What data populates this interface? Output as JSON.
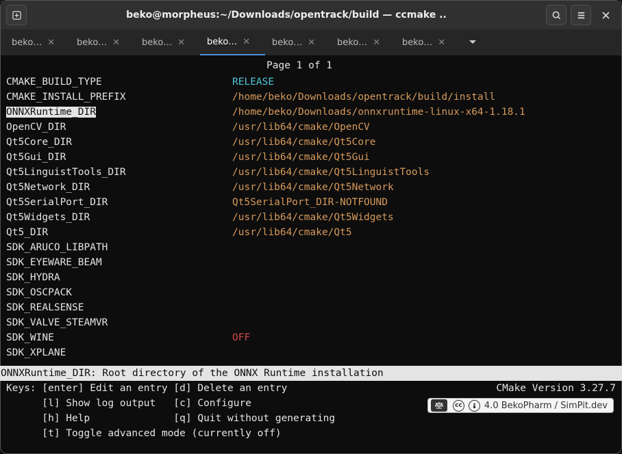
{
  "titlebar": {
    "title": "beko@morpheus:~/Downloads/opentrack/build — ccmake .."
  },
  "tabs": [
    {
      "label": "beko…",
      "active": false
    },
    {
      "label": "beko…",
      "active": false
    },
    {
      "label": "beko…",
      "active": false
    },
    {
      "label": "beko…",
      "active": true
    },
    {
      "label": "beko…",
      "active": false
    },
    {
      "label": "beko…",
      "active": false
    },
    {
      "label": "beko…",
      "active": false
    }
  ],
  "ccmake": {
    "page_info": "Page 1 of 1",
    "entries": [
      {
        "key": "CMAKE_BUILD_TYPE",
        "value": "RELEASE",
        "vclass": "val-cyan",
        "highlighted": false
      },
      {
        "key": "CMAKE_INSTALL_PREFIX",
        "value": "/home/beko/Downloads/opentrack/build/install",
        "vclass": "val-orange",
        "highlighted": false
      },
      {
        "key": "ONNXRuntime_DIR",
        "value": "/home/beko/Downloads/onnxruntime-linux-x64-1.18.1",
        "vclass": "val-orange",
        "highlighted": true
      },
      {
        "key": "OpenCV_DIR",
        "value": "/usr/lib64/cmake/OpenCV",
        "vclass": "val-orange",
        "highlighted": false
      },
      {
        "key": "Qt5Core_DIR",
        "value": "/usr/lib64/cmake/Qt5Core",
        "vclass": "val-orange",
        "highlighted": false
      },
      {
        "key": "Qt5Gui_DIR",
        "value": "/usr/lib64/cmake/Qt5Gui",
        "vclass": "val-orange",
        "highlighted": false
      },
      {
        "key": "Qt5LinguistTools_DIR",
        "value": "/usr/lib64/cmake/Qt5LinguistTools",
        "vclass": "val-orange",
        "highlighted": false
      },
      {
        "key": "Qt5Network_DIR",
        "value": "/usr/lib64/cmake/Qt5Network",
        "vclass": "val-orange",
        "highlighted": false
      },
      {
        "key": "Qt5SerialPort_DIR",
        "value": "Qt5SerialPort_DIR-NOTFOUND",
        "vclass": "val-orange",
        "highlighted": false
      },
      {
        "key": "Qt5Widgets_DIR",
        "value": "/usr/lib64/cmake/Qt5Widgets",
        "vclass": "val-orange",
        "highlighted": false
      },
      {
        "key": "Qt5_DIR",
        "value": "/usr/lib64/cmake/Qt5",
        "vclass": "val-orange",
        "highlighted": false
      },
      {
        "key": "SDK_ARUCO_LIBPATH",
        "value": "",
        "vclass": "",
        "highlighted": false
      },
      {
        "key": "SDK_EYEWARE_BEAM",
        "value": "",
        "vclass": "",
        "highlighted": false
      },
      {
        "key": "SDK_HYDRA",
        "value": "",
        "vclass": "",
        "highlighted": false
      },
      {
        "key": "SDK_OSCPACK",
        "value": "",
        "vclass": "",
        "highlighted": false
      },
      {
        "key": "SDK_REALSENSE",
        "value": "",
        "vclass": "",
        "highlighted": false
      },
      {
        "key": "SDK_VALVE_STEAMVR",
        "value": "",
        "vclass": "",
        "highlighted": false
      },
      {
        "key": "SDK_WINE",
        "value": "OFF",
        "vclass": "val-red",
        "highlighted": false
      },
      {
        "key": "SDK_XPLANE",
        "value": "",
        "vclass": "",
        "highlighted": false
      }
    ],
    "description": "ONNXRuntime_DIR: Root directory of the ONNX Runtime installation",
    "version": "CMake Version 3.27.7",
    "keys": {
      "r1l": "Keys: [enter] Edit an entry [d] Delete an entry",
      "r2": "      [l] Show log output   [c] Configure",
      "r3": "      [h] Help              [q] Quit without generating",
      "r4": "      [t] Toggle advanced mode (currently off)"
    }
  },
  "license": {
    "text": "4.0 BekoPharm / SimPit.dev"
  }
}
